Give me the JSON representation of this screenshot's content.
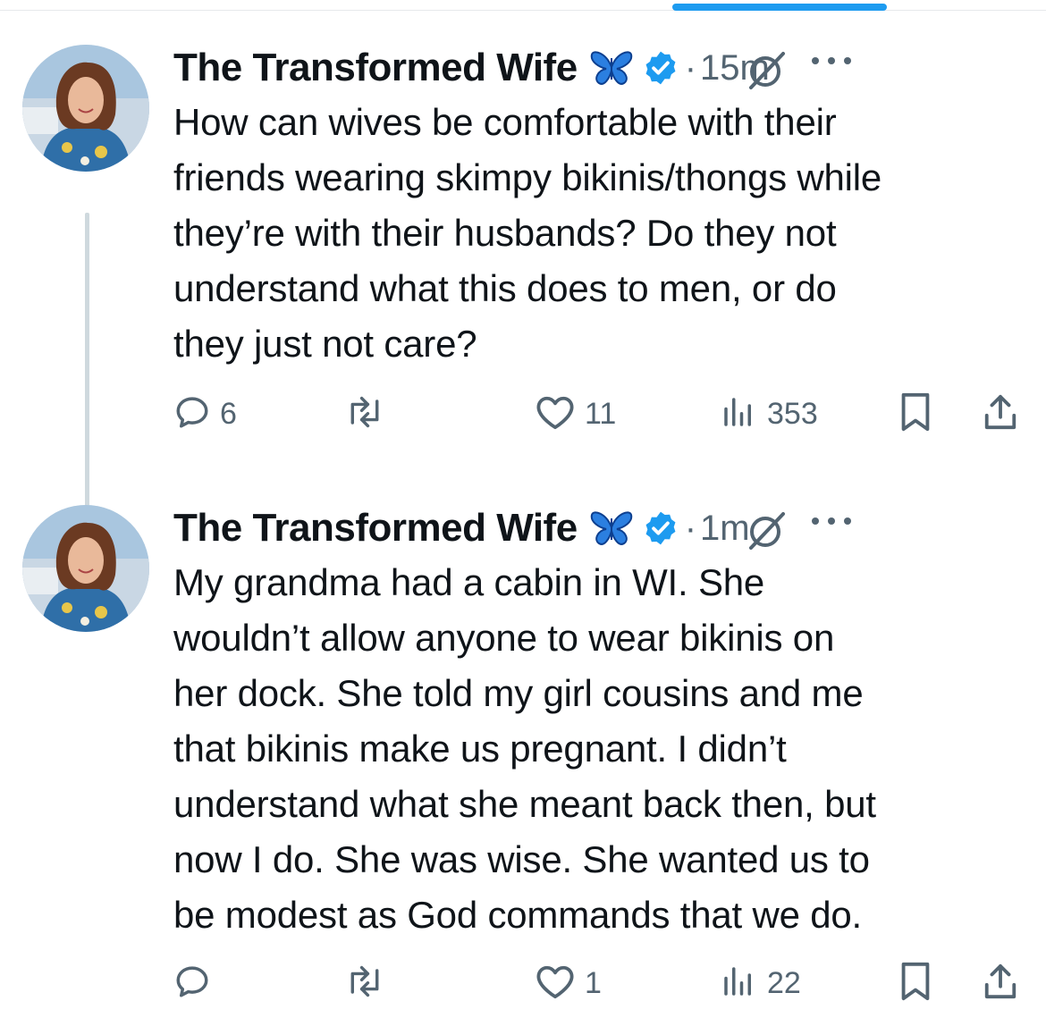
{
  "tweets": [
    {
      "author": "The Transformed Wife",
      "time": "15m",
      "text": "How can wives be comfortable with their\nfriends wearing skimpy bikinis/thongs while\nthey’re with their husbands? Do they not\nunderstand what this does to men, or do\nthey just not care?",
      "replies": "6",
      "reposts": "",
      "likes": "11",
      "views": "353"
    },
    {
      "author": "The Transformed Wife",
      "time": "1m",
      "text": "My grandma had a cabin in WI. She\nwouldn’t allow anyone to wear bikinis on\nher dock. She told my girl cousins and me\nthat bikinis make us pregnant. I didn’t\nunderstand what she meant back then, but\nnow I do. She was wise. She wanted us to\nbe modest as God commands that we do.",
      "replies": "",
      "reposts": "",
      "likes": "1",
      "views": "22"
    }
  ],
  "separator": "·",
  "icons": {
    "reply": "reply-icon",
    "repost": "repost-icon",
    "like": "heart-icon",
    "views": "views-icon",
    "bookmark": "bookmark-icon",
    "share": "share-icon",
    "grok": "grok-icon",
    "more": "more-icon",
    "verified": "verified-badge-icon",
    "butterfly": "butterfly-emoji-icon"
  },
  "colors": {
    "accent": "#1d9bf0",
    "text": "#0f1419",
    "secondary": "#536471",
    "butterfly": "#1f6fd6"
  }
}
